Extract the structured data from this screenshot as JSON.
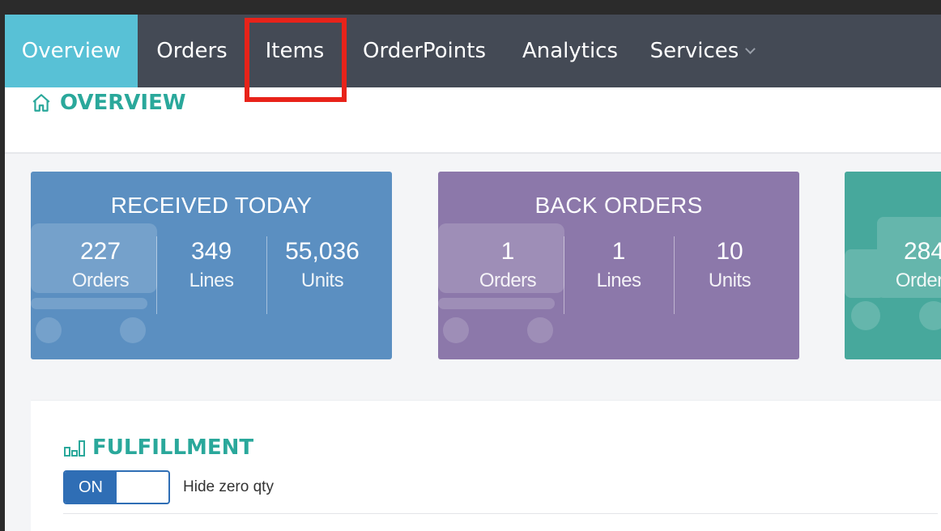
{
  "nav": {
    "items": [
      {
        "label": "Overview"
      },
      {
        "label": "Orders"
      },
      {
        "label": "Items"
      },
      {
        "label": "OrderPoints"
      },
      {
        "label": "Analytics"
      },
      {
        "label": "Services"
      }
    ]
  },
  "page": {
    "title": "OVERVIEW"
  },
  "cards": {
    "received": {
      "title": "RECEIVED TODAY",
      "stats": [
        {
          "value": "227",
          "label": "Orders"
        },
        {
          "value": "349",
          "label": "Lines"
        },
        {
          "value": "55,036",
          "label": "Units"
        }
      ],
      "color": "#5b8fc1"
    },
    "back_orders": {
      "title": "BACK ORDERS",
      "stats": [
        {
          "value": "1",
          "label": "Orders"
        },
        {
          "value": "1",
          "label": "Lines"
        },
        {
          "value": "10",
          "label": "Units"
        }
      ],
      "color": "#8c78aa"
    },
    "third": {
      "stats": [
        {
          "value": "284",
          "label": "Orders"
        }
      ],
      "color": "#47a89c"
    }
  },
  "fulfillment": {
    "title": "FULFILLMENT",
    "toggle_label": "ON",
    "hide_zero_label": "Hide zero qty"
  },
  "colors": {
    "accent": "#2aa89b",
    "nav_bg": "#444a55",
    "nav_active": "#58c1d6",
    "highlight": "#e8231a"
  }
}
